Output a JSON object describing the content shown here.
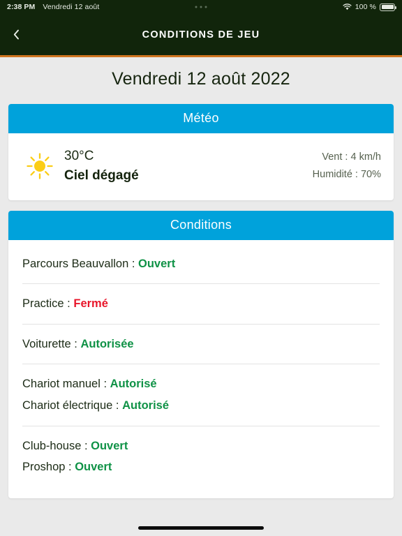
{
  "status_bar": {
    "time": "2:38 PM",
    "date": "Vendredi 12 août",
    "wifi_icon": "wifi-icon",
    "battery_percent": "100 %",
    "battery_icon": "battery-full-icon",
    "menu_dots_icon": "three-dots-icon"
  },
  "nav": {
    "back_icon": "chevron-left-icon",
    "title": "CONDITIONS DE JEU",
    "background_color": "#11250b",
    "accent_color": "#cf7520"
  },
  "page": {
    "title": "Vendredi 12 août 2022",
    "background_color": "#eaeaea"
  },
  "weather_card": {
    "header": "Météo",
    "header_color": "#00a2db",
    "icon": "sun-icon",
    "icon_color": "#f6cc1b",
    "temperature": "30°C",
    "description": "Ciel dégagé",
    "wind": "Vent : 4 km/h",
    "humidity": "Humidité : 70%"
  },
  "conditions_card": {
    "header": "Conditions",
    "header_color": "#00a2db",
    "open_color": "#0f9246",
    "closed_color": "#e8162a",
    "groups": [
      {
        "rows": [
          {
            "label": "Parcours Beauvallon :",
            "value": "Ouvert",
            "state": "open"
          }
        ]
      },
      {
        "rows": [
          {
            "label": "Practice  :",
            "value": "Fermé",
            "state": "closed"
          }
        ]
      },
      {
        "rows": [
          {
            "label": "Voiturette  :",
            "value": "Autorisée",
            "state": "open"
          }
        ]
      },
      {
        "rows": [
          {
            "label": "Chariot manuel  :",
            "value": "Autorisé",
            "state": "open"
          },
          {
            "label": "Chariot électrique  :",
            "value": "Autorisé",
            "state": "open"
          }
        ]
      },
      {
        "rows": [
          {
            "label": "Club-house  :",
            "value": "Ouvert",
            "state": "open"
          },
          {
            "label": "Proshop  :",
            "value": "Ouvert",
            "state": "open"
          }
        ]
      }
    ]
  },
  "home_indicator": "home-indicator"
}
